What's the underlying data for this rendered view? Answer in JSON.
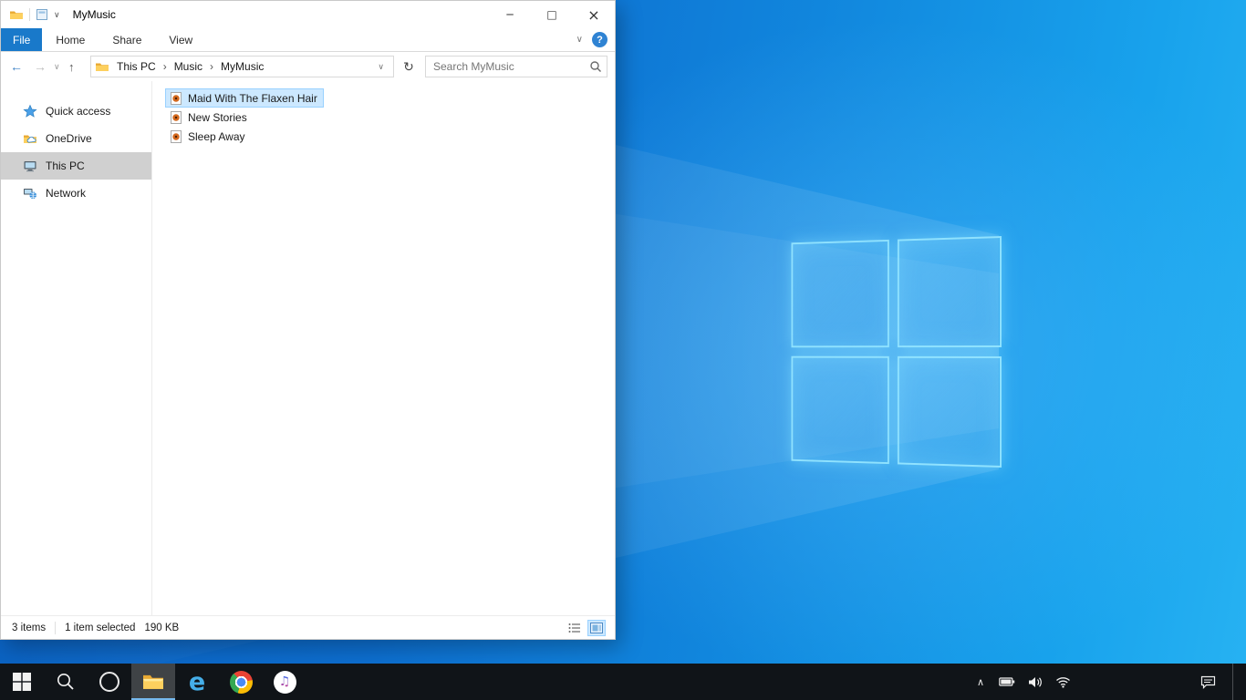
{
  "icons": {
    "minimize": "─",
    "maximize": "□",
    "close": "×",
    "help": "?",
    "chevron_down": "∨",
    "chevron_up": "∧",
    "chevron_right": "›",
    "back": "←",
    "forward": "→",
    "up": "↑",
    "refresh": "↻",
    "music_note": "♫",
    "edge_glyph": "e"
  },
  "explorer": {
    "title": "MyMusic",
    "ribbon": {
      "tabs": [
        {
          "label": "File",
          "active": true
        },
        {
          "label": "Home",
          "active": false
        },
        {
          "label": "Share",
          "active": false
        },
        {
          "label": "View",
          "active": false
        }
      ]
    },
    "address": {
      "crumbs": [
        "This PC",
        "Music",
        "MyMusic"
      ]
    },
    "search": {
      "placeholder": "Search MyMusic"
    },
    "sidebar": {
      "items": [
        {
          "label": "Quick access",
          "icon": "star-icon",
          "selected": false
        },
        {
          "label": "OneDrive",
          "icon": "onedrive-folder-icon",
          "selected": false
        },
        {
          "label": "This PC",
          "icon": "computer-icon",
          "selected": true
        },
        {
          "label": "Network",
          "icon": "network-icon",
          "selected": false
        }
      ]
    },
    "files": [
      {
        "name": "Maid With The Flaxen Hair",
        "icon": "audio-file-icon",
        "selected": true
      },
      {
        "name": "New Stories",
        "icon": "audio-file-icon",
        "selected": false
      },
      {
        "name": "Sleep Away",
        "icon": "audio-file-icon",
        "selected": false
      }
    ],
    "status": {
      "items": "3 items",
      "selected": "1 item selected",
      "size": "190 KB"
    }
  },
  "taskbar": {
    "buttons": [
      "start",
      "search",
      "cortana",
      "file-explorer",
      "edge",
      "chrome",
      "itunes"
    ],
    "active_button": "file-explorer",
    "tray_icons": [
      "hidden-icons-chevron",
      "battery",
      "volume",
      "wifi",
      "action-center"
    ]
  },
  "colors": {
    "file_tab_blue": "#1979ca",
    "selection_blue": "#cce8ff",
    "selection_border": "#99d1ff",
    "taskbar_dark": "#101418",
    "desktop_blue": "#1186dd"
  }
}
